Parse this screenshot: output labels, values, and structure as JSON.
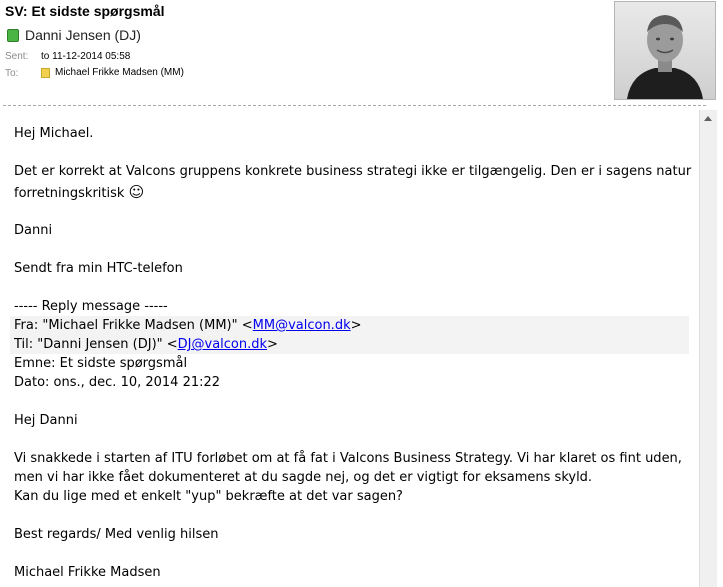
{
  "email": {
    "subject": "SV: Et sidste spørgsmål",
    "sender": "Danni Jensen (DJ)",
    "sent_label": "Sent:",
    "sent_value": "to 11-12-2014 05:58",
    "to_label": "To:",
    "to_value": "Michael Frikke Madsen (MM)"
  },
  "body": {
    "greeting": "Hej Michael.",
    "p1_line1": "Det er korrekt at Valcons gruppens konkrete business strategi ikke er tilgængelig. Den er i sagens natur",
    "p1_line2": "forretningskritisk",
    "p1_emoji": "☺",
    "signoff": "Danni",
    "sent_from": "Sendt fra min HTC-telefon",
    "reply_header": "----- Reply message -----",
    "fra_prefix": "Fra: \"Michael Frikke Madsen (MM)\" <",
    "fra_email": "MM@valcon.dk",
    "fra_suffix": ">",
    "til_prefix": "Til: \"Danni Jensen (DJ)\" <",
    "til_email": "DJ@valcon.dk",
    "til_suffix": ">",
    "emne": "Emne: Et sidste spørgsmål",
    "dato": "Dato: ons., dec. 10, 2014 21:22",
    "greeting2": "Hej Danni",
    "p2_line1": "Vi snakkede i starten af ITU forløbet om at få fat i Valcons Business Strategy. Vi har klaret os fint uden,",
    "p2_line2": "men vi har ikke fået dokumenteret at du sagde nej, og det er vigtigt for eksamens skyld.",
    "p2_line3": "Kan du lige med et enkelt \"yup\" bekræfte at det var sagen?",
    "regards": "Best regards/ Med venlig hilsen",
    "name": "Michael Frikke Madsen"
  }
}
